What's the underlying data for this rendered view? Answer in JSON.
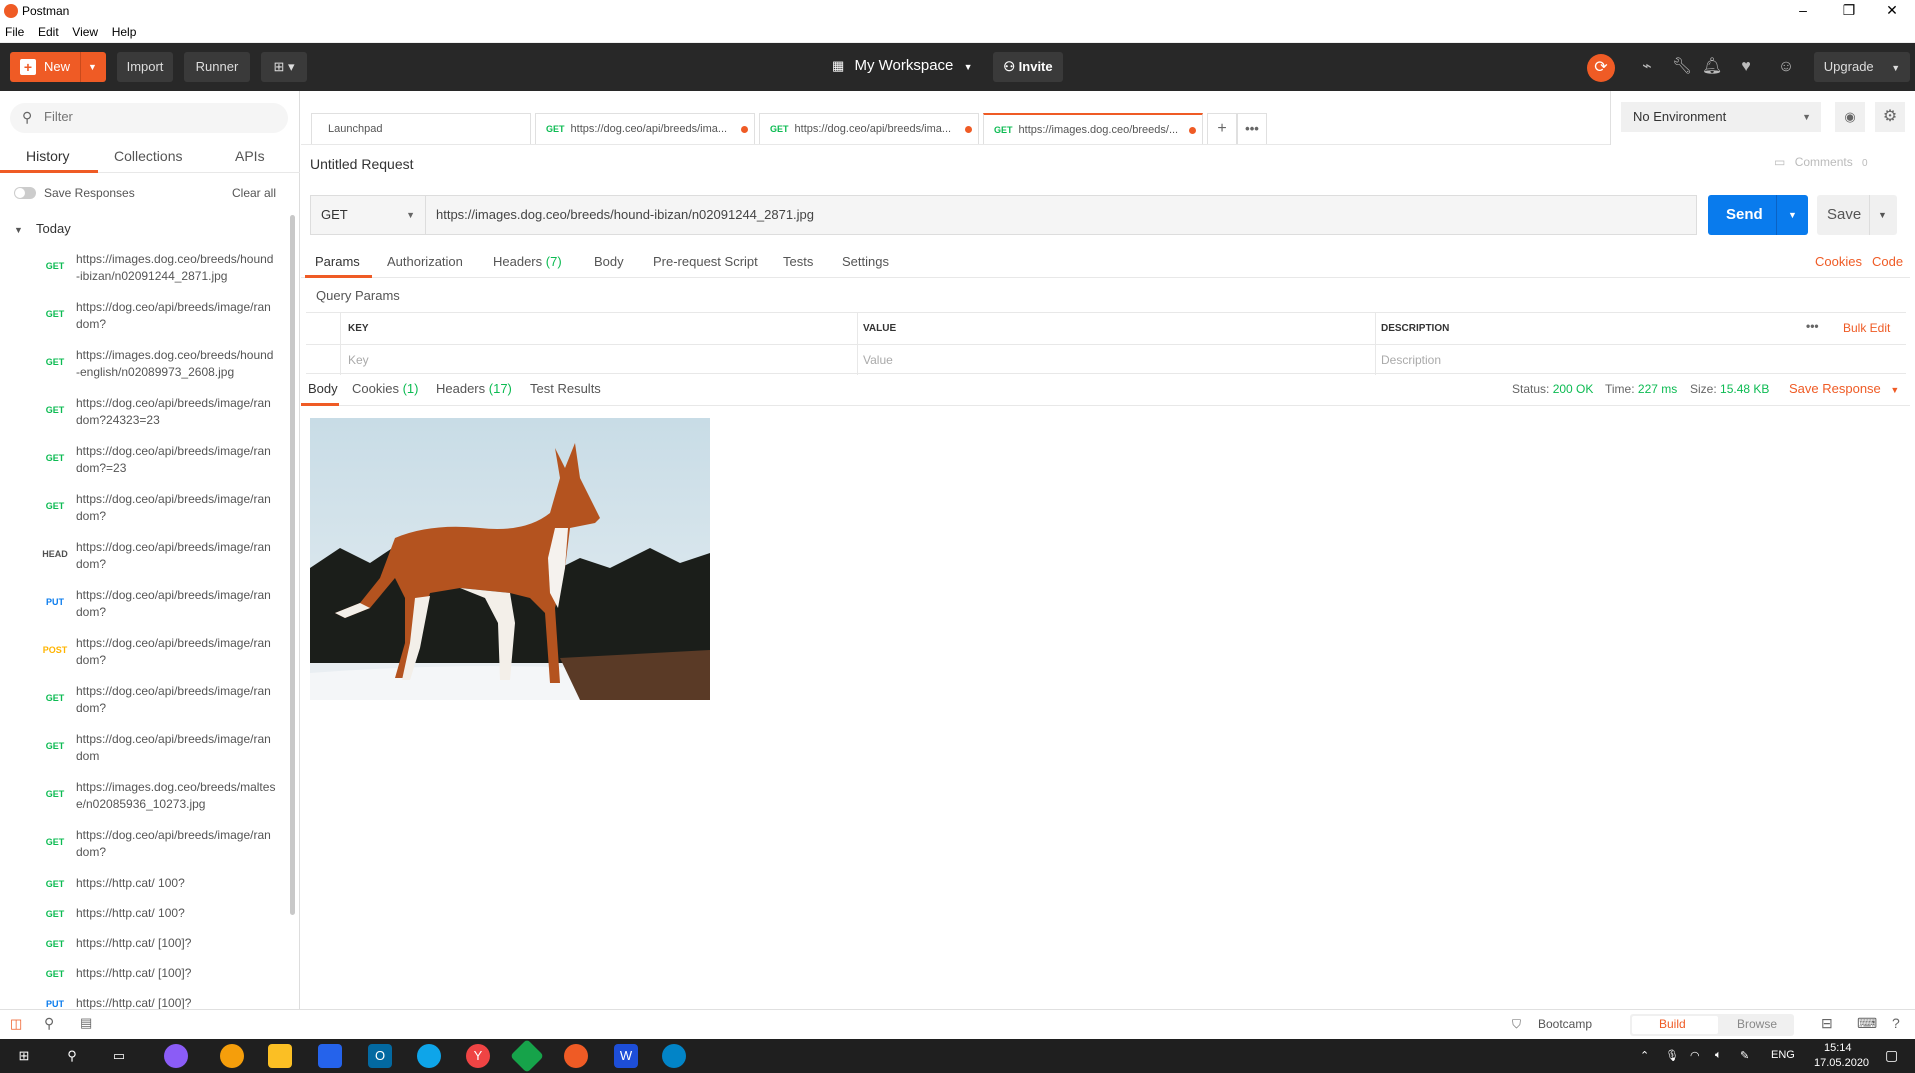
{
  "window": {
    "title": "Postman"
  },
  "menu": [
    "File",
    "Edit",
    "View",
    "Help"
  ],
  "header": {
    "new_label": "New",
    "import_label": "Import",
    "runner_label": "Runner",
    "workspace": "My Workspace",
    "invite": "Invite",
    "upgrade": "Upgrade"
  },
  "sidebar": {
    "filter_placeholder": "Filter",
    "tabs": [
      "History",
      "Collections",
      "APIs"
    ],
    "save_responses": "Save Responses",
    "clear_all": "Clear all",
    "group": "Today",
    "history": [
      {
        "method": "GET",
        "url": "https://images.dog.ceo/breeds/hound-ibizan/n02091244_2871.jpg"
      },
      {
        "method": "GET",
        "url": "https://dog.ceo/api/breeds/image/random?"
      },
      {
        "method": "GET",
        "url": "https://images.dog.ceo/breeds/hound-english/n02089973_2608.jpg"
      },
      {
        "method": "GET",
        "url": "https://dog.ceo/api/breeds/image/random?24323=23"
      },
      {
        "method": "GET",
        "url": "https://dog.ceo/api/breeds/image/random?=23"
      },
      {
        "method": "GET",
        "url": "https://dog.ceo/api/breeds/image/random?"
      },
      {
        "method": "HEAD",
        "url": "https://dog.ceo/api/breeds/image/random?"
      },
      {
        "method": "PUT",
        "url": "https://dog.ceo/api/breeds/image/random?"
      },
      {
        "method": "POST",
        "url": "https://dog.ceo/api/breeds/image/random?"
      },
      {
        "method": "GET",
        "url": "https://dog.ceo/api/breeds/image/random?"
      },
      {
        "method": "GET",
        "url": "https://dog.ceo/api/breeds/image/random"
      },
      {
        "method": "GET",
        "url": "https://images.dog.ceo/breeds/maltese/n02085936_10273.jpg"
      },
      {
        "method": "GET",
        "url": "https://dog.ceo/api/breeds/image/random?"
      },
      {
        "method": "GET",
        "url": "https://http.cat/ 100?"
      },
      {
        "method": "GET",
        "url": "https://http.cat/ 100?"
      },
      {
        "method": "GET",
        "url": "https://http.cat/ [100]?"
      },
      {
        "method": "GET",
        "url": "https://http.cat/ [100]?"
      },
      {
        "method": "PUT",
        "url": "https://http.cat/ [100]?"
      }
    ]
  },
  "request_tabs": [
    {
      "method": "",
      "label": "Launchpad"
    },
    {
      "method": "GET",
      "label": "https://dog.ceo/api/breeds/ima..."
    },
    {
      "method": "GET",
      "label": "https://dog.ceo/api/breeds/ima..."
    },
    {
      "method": "GET",
      "label": "https://images.dog.ceo/breeds/..."
    }
  ],
  "environment": "No Environment",
  "comments": {
    "label": "Comments",
    "count": "0"
  },
  "request": {
    "title": "Untitled Request",
    "method": "GET",
    "url": "https://images.dog.ceo/breeds/hound-ibizan/n02091244_2871.jpg",
    "send": "Send",
    "save": "Save"
  },
  "subtabs": {
    "params": "Params",
    "authorization": "Authorization",
    "headers": "Headers",
    "headers_count": "(7)",
    "body": "Body",
    "prerequest": "Pre-request Script",
    "tests": "Tests",
    "settings": "Settings",
    "cookies": "Cookies",
    "code": "Code"
  },
  "query": {
    "title": "Query Params",
    "key_h": "KEY",
    "value_h": "VALUE",
    "desc_h": "DESCRIPTION",
    "bulk_edit": "Bulk Edit",
    "key_ph": "Key",
    "value_ph": "Value",
    "desc_ph": "Description"
  },
  "response": {
    "body": "Body",
    "cookies": "Cookies",
    "cookies_count": "(1)",
    "headers": "Headers",
    "headers_count": "(17)",
    "test_results": "Test Results",
    "status_label": "Status:",
    "status": "200 OK",
    "time_label": "Time:",
    "time": "227 ms",
    "size_label": "Size:",
    "size": "15.48 KB",
    "save_response": "Save Response"
  },
  "statusbar": {
    "bootcamp": "Bootcamp",
    "build": "Build",
    "browse": "Browse"
  },
  "taskbar": {
    "lang": "ENG",
    "time": "15:14",
    "date": "17.05.2020"
  },
  "colors": {
    "accent": "#ef5b25",
    "send": "#097bed",
    "get": "#0cbb52"
  }
}
